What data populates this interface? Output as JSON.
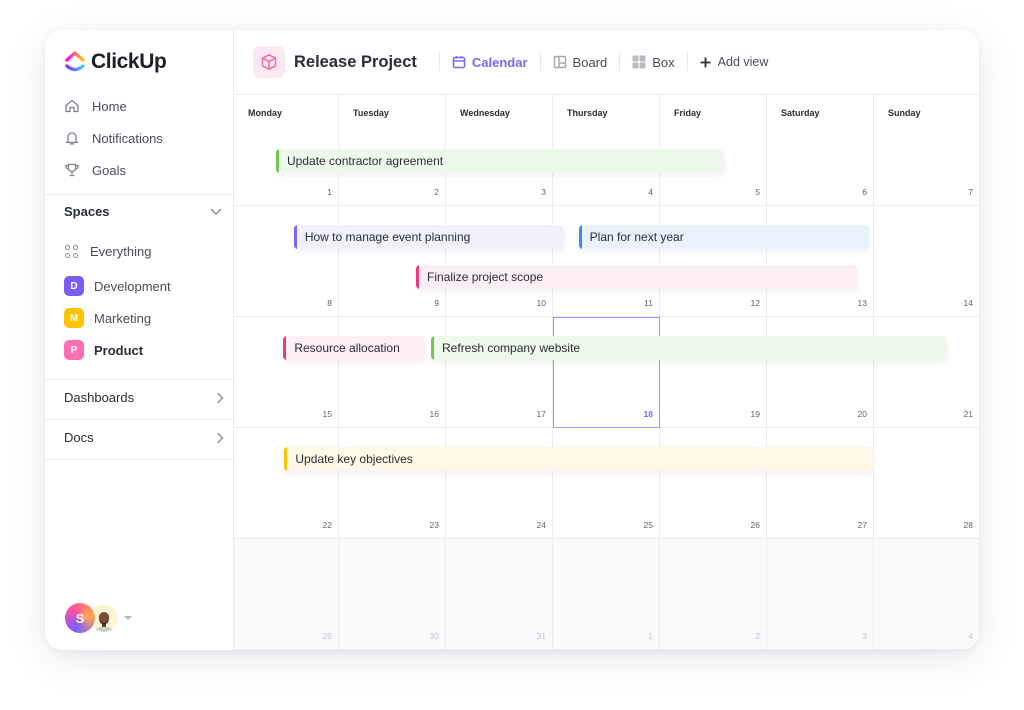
{
  "app": {
    "name": "ClickUp"
  },
  "sidebar": {
    "nav": [
      {
        "label": "Home",
        "icon": "home-icon"
      },
      {
        "label": "Notifications",
        "icon": "bell-icon"
      },
      {
        "label": "Goals",
        "icon": "trophy-icon"
      }
    ],
    "spaces_label": "Spaces",
    "everything_label": "Everything",
    "spaces": [
      {
        "letter": "D",
        "label": "Development",
        "color": "#7b5cf5"
      },
      {
        "letter": "M",
        "label": "Marketing",
        "color": "#ffc300"
      },
      {
        "letter": "P",
        "label": "Product",
        "color": "#ff6fb1",
        "active": true
      }
    ],
    "dashboards_label": "Dashboards",
    "docs_label": "Docs",
    "user_initial": "S"
  },
  "header": {
    "project_title": "Release Project",
    "views": [
      {
        "label": "Calendar",
        "icon": "calendar-icon",
        "active": true
      },
      {
        "label": "Board",
        "icon": "board-icon"
      },
      {
        "label": "Box",
        "icon": "box-icon"
      }
    ],
    "add_view_label": "Add view"
  },
  "calendar": {
    "weekdays": [
      "Monday",
      "Tuesday",
      "Wednesday",
      "Thursday",
      "Friday",
      "Saturday",
      "Sunday"
    ],
    "weeks": [
      [
        "1",
        "2",
        "3",
        "4",
        "5",
        "6",
        "7"
      ],
      [
        "8",
        "9",
        "10",
        "11",
        "12",
        "13",
        "14"
      ],
      [
        "15",
        "16",
        "17",
        "18",
        "19",
        "20",
        "21"
      ],
      [
        "22",
        "23",
        "24",
        "25",
        "26",
        "27",
        "28"
      ],
      [
        "29",
        "30",
        "31",
        "1",
        "2",
        "3",
        "4"
      ]
    ],
    "muted_week": 4,
    "today": "18",
    "events": [
      {
        "title": "Update contractor agreement",
        "color": "#6bc950",
        "bg": "#eef9ec",
        "week": 0,
        "start": 0.4,
        "end": 4.6,
        "row": 0
      },
      {
        "title": "How to manage event planning",
        "color": "#7b68ee",
        "bg": "#f1f0fd",
        "week": 1,
        "start": 0.57,
        "end": 3.1,
        "row": 0
      },
      {
        "title": "Plan for next year",
        "color": "#3d8af7",
        "bg": "#eaf2fe",
        "week": 1,
        "start": 3.24,
        "end": 5.95,
        "row": 0
      },
      {
        "title": "Finalize project scope",
        "color": "#e83e7c",
        "bg": "#fdeff5",
        "week": 1,
        "start": 1.72,
        "end": 5.85,
        "row": 1
      },
      {
        "title": "Resource allocation",
        "color": "#e83e7c",
        "bg": "#fdeff5",
        "week": 2,
        "start": 0.47,
        "end": 1.8,
        "row": 0
      },
      {
        "title": "Refresh company website",
        "color": "#6bc950",
        "bg": "#eef9ec",
        "week": 2,
        "start": 1.86,
        "end": 6.7,
        "row": 0
      },
      {
        "title": "Update key objectives",
        "color": "#ffc300",
        "bg": "#fff8e6",
        "week": 3,
        "start": 0.48,
        "end": 6.0,
        "row": 0
      }
    ]
  }
}
